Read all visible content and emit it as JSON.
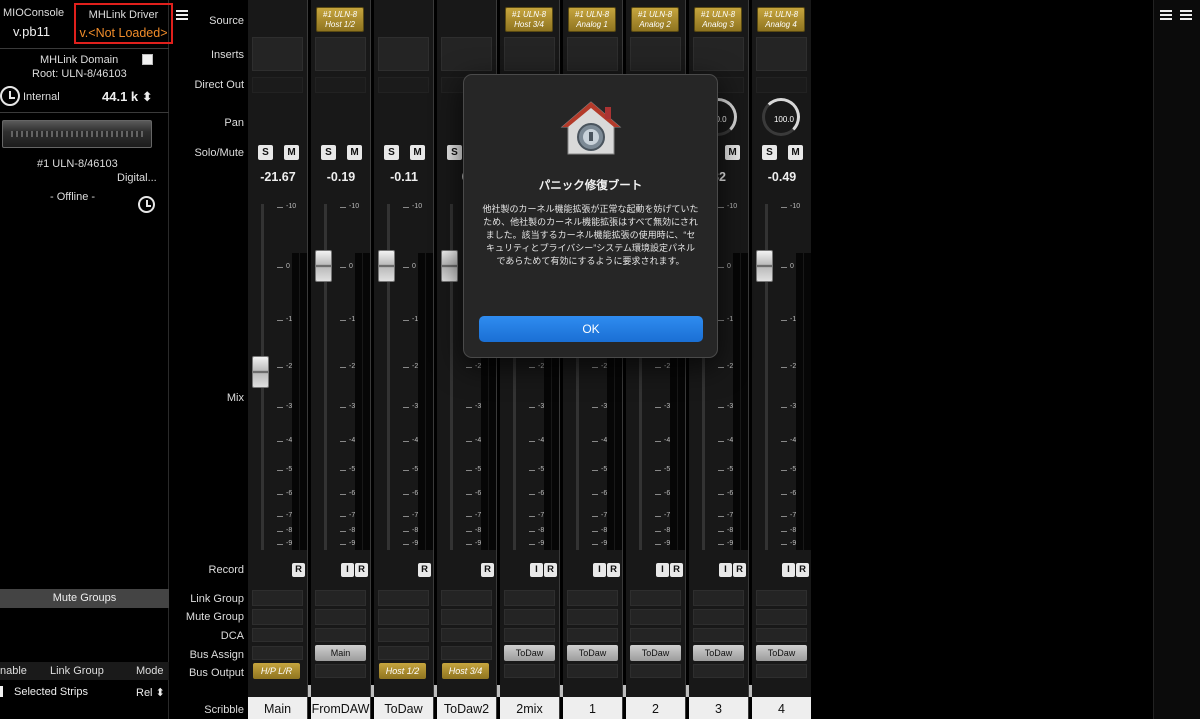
{
  "app": {
    "title": "MIOConsole",
    "version": "v.pb11",
    "driver_title": "MHLink Driver",
    "driver_version": "v.<Not Loaded>",
    "accent_warning": "#f08c2a",
    "highlight_box": "#e0201c"
  },
  "domain": {
    "label": "MHLink Domain",
    "root": "Root: ULN-8/46103",
    "clock_source": "Internal",
    "sample_rate": "44.1 k ⬍"
  },
  "device": {
    "name": "#1 ULN-8/46103",
    "digital": "Digital...",
    "status": "- Offline -"
  },
  "left_footer": {
    "mute_groups": "Mute Groups",
    "enable": "nable",
    "link_group": "Link Group",
    "mode": "Mode",
    "selected_strips": "Selected Strips",
    "rel": "Rel ⬍"
  },
  "rows": {
    "source": "Source",
    "inserts": "Inserts",
    "direct_out": "Direct Out",
    "pan": "Pan",
    "solo_mute": "Solo/Mute",
    "mix": "Mix",
    "record": "Record",
    "link_group": "Link Group",
    "mute_group": "Mute Group",
    "dca": "DCA",
    "bus_assign": "Bus Assign",
    "bus_output": "Bus Output",
    "scribble": "Scribble"
  },
  "scale_ticks": [
    "-10",
    "0",
    "-10",
    "-20",
    "-30",
    "-40",
    "-50",
    "-60",
    "-70",
    "-80",
    "-90"
  ],
  "strips": [
    {
      "source": "",
      "level": "-21.67",
      "fader_db": -21.67,
      "record": [
        "R"
      ],
      "bus_assign": "",
      "bus_output": "H/P L/R",
      "scribble": "Main"
    },
    {
      "source": "#1 ULN-8\nHost 1/2",
      "level": "-0.19",
      "fader_db": -0.19,
      "record": [
        "I",
        "R"
      ],
      "bus_assign": "Main",
      "bus_output": "",
      "scribble": "FromDAW"
    },
    {
      "source": "",
      "level": "-0.11",
      "fader_db": -0.11,
      "record": [
        "R"
      ],
      "bus_assign": "",
      "bus_output": "Host 1/2",
      "scribble": "ToDaw"
    },
    {
      "source": "",
      "level": "0.",
      "fader_db": 0,
      "record": [
        "R"
      ],
      "bus_assign": "",
      "bus_output": "Host 3/4",
      "scribble": "ToDaw2"
    },
    {
      "source": "#1 ULN-8\nHost 3/4",
      "level": "",
      "fader_db": null,
      "record": [
        "I",
        "R"
      ],
      "bus_assign": "ToDaw",
      "bus_output": "",
      "scribble": "2mix"
    },
    {
      "source": "#1 ULN-8\nAnalog 1",
      "level": "",
      "fader_db": null,
      "record": [
        "I",
        "R"
      ],
      "bus_assign": "ToDaw",
      "bus_output": "",
      "scribble": "1"
    },
    {
      "source": "#1 ULN-8\nAnalog 2",
      "level": "",
      "fader_db": null,
      "record": [
        "I",
        "R"
      ],
      "bus_assign": "ToDaw",
      "bus_output": "",
      "scribble": "2"
    },
    {
      "source": "#1 ULN-8\nAnalog 3",
      "level": "32",
      "fader_db": null,
      "record": [
        "I",
        "R"
      ],
      "bus_assign": "ToDaw",
      "bus_output": "",
      "scribble": "3",
      "pan": "0.0"
    },
    {
      "source": "#1 ULN-8\nAnalog 4",
      "level": "-0.49",
      "fader_db": -0.49,
      "record": [
        "I",
        "R"
      ],
      "bus_assign": "ToDaw",
      "bus_output": "",
      "scribble": "4",
      "pan": "100.0"
    }
  ],
  "dialog": {
    "title": "パニック修復ブート",
    "body": "他社製のカーネル機能拡張が正常な起動を妨げていたため、他社製のカーネル機能拡張はすべて無効にされました。該当するカーネル機能拡張の使用時に、“セキュリティとプライバシー”システム環境設定パネルであらためて有効にするように要求されます。",
    "ok_label": "OK",
    "ok_color": "#2f8cf0"
  }
}
